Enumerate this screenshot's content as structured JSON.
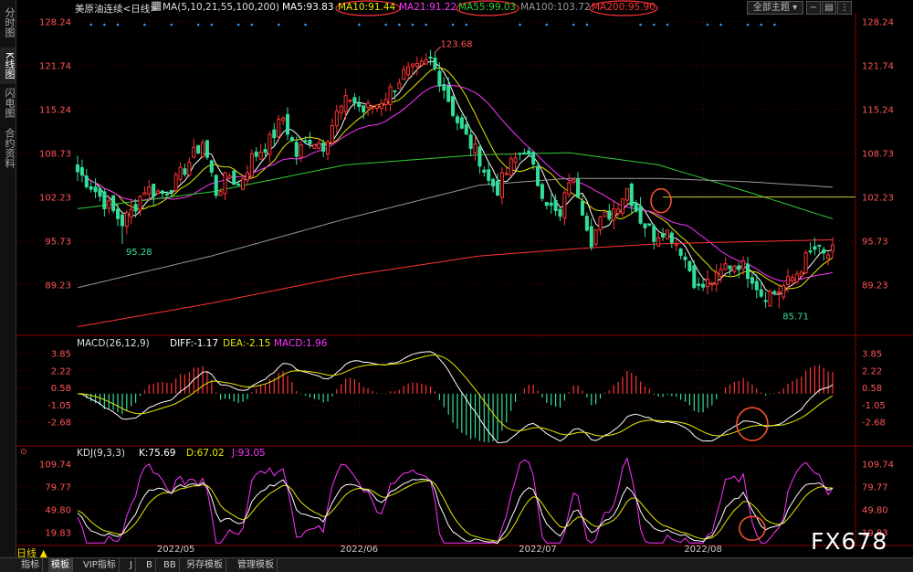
{
  "sidebar": {
    "tabs": [
      {
        "label": "分时图",
        "active": false
      },
      {
        "label": "K线图",
        "active": true
      },
      {
        "label": "闪电图",
        "active": false
      },
      {
        "label": "合约资料",
        "active": false
      }
    ]
  },
  "header": {
    "symbol": "美原油连续<日线>",
    "ma_params": "MA(5,10,21,55,100,200)",
    "ma5": "MA5:93.83",
    "ma10": "MA10:91.44",
    "ma21": "MA21:91.22",
    "ma55": "MA55:99.03",
    "ma100": "MA100:103.72",
    "ma200": "MA200:95.90",
    "theme_button": "全部主题",
    "colors": {
      "ma5": "#ffffff",
      "ma10": "#e6e600",
      "ma21": "#ff33ff",
      "ma55": "#33cc33",
      "ma100": "#999999",
      "ma200": "#ff3333"
    }
  },
  "macd_header": {
    "params": "MACD(26,12,9)",
    "diff": "DIFF:-1.17",
    "dea": "DEA:-2.15",
    "macd": "MACD:1.96"
  },
  "kdj_header": {
    "params": "KDJ(9,3,3)",
    "k": "K:75.69",
    "d": "D:67.02",
    "j": "J:93.05"
  },
  "bottom_bar": {
    "period": "日线 ▲",
    "tabs": [
      "指标",
      "模板",
      "VIP指标",
      "J",
      "B",
      "BB",
      "另存模板",
      "管理模板"
    ],
    "active_tab": "模板"
  },
  "watermark": "FX678",
  "chart_data": [
    {
      "type": "candlestick",
      "title": "美原油连续<日线>",
      "ylim": [
        82,
        129
      ],
      "y_ticks": [
        128.24,
        121.74,
        115.24,
        108.73,
        102.23,
        95.73,
        89.23
      ],
      "x_tick_labels": [
        {
          "label": "2022/05",
          "index": 22
        },
        {
          "label": "2022/06",
          "index": 63
        },
        {
          "label": "2022/07",
          "index": 103
        },
        {
          "label": "2022/08",
          "index": 140
        }
      ],
      "annotations": [
        {
          "text": "123.68",
          "index": 80,
          "value": 123.68,
          "kind": "high"
        },
        {
          "text": "95.28",
          "index": 10,
          "value": 95.28,
          "kind": "low"
        },
        {
          "text": "85.71",
          "index": 157,
          "value": 85.71,
          "kind": "low"
        }
      ],
      "reference_line": {
        "value": 102.23,
        "from_index": 131
      },
      "anchors": [
        [
          0,
          106.0
        ],
        [
          3,
          104.0
        ],
        [
          6,
          101.5
        ],
        [
          10,
          98.5
        ],
        [
          12,
          100.0
        ],
        [
          15,
          103.5
        ],
        [
          19,
          102.8
        ],
        [
          22,
          104.5
        ],
        [
          25,
          107.5
        ],
        [
          28,
          110.5
        ],
        [
          31,
          103.0
        ],
        [
          34,
          105.5
        ],
        [
          36,
          104.0
        ],
        [
          39,
          108.0
        ],
        [
          43,
          110.5
        ],
        [
          46,
          114.0
        ],
        [
          49,
          108.5
        ],
        [
          52,
          111.0
        ],
        [
          55,
          110.0
        ],
        [
          58,
          114.5
        ],
        [
          61,
          117.0
        ],
        [
          64,
          115.0
        ],
        [
          67,
          116.0
        ],
        [
          70,
          118.0
        ],
        [
          73,
          120.5
        ],
        [
          76,
          121.0
        ],
        [
          79,
          122.5
        ],
        [
          82,
          118.5
        ],
        [
          84,
          115.0
        ],
        [
          86,
          112.0
        ],
        [
          88,
          110.0
        ],
        [
          90,
          108.0
        ],
        [
          92,
          104.5
        ],
        [
          94,
          103.5
        ],
        [
          97,
          107.0
        ],
        [
          100,
          109.5
        ],
        [
          103,
          104.5
        ],
        [
          106,
          100.5
        ],
        [
          108,
          99.0
        ],
        [
          110,
          105.0
        ],
        [
          112,
          103.0
        ],
        [
          115,
          96.0
        ],
        [
          117,
          98.5
        ],
        [
          120,
          100.5
        ],
        [
          123,
          103.5
        ],
        [
          126,
          99.0
        ],
        [
          129,
          96.5
        ],
        [
          131,
          97.5
        ],
        [
          133,
          96.5
        ],
        [
          135,
          94.5
        ],
        [
          137,
          91.5
        ],
        [
          139,
          88.5
        ],
        [
          141,
          89.5
        ],
        [
          143,
          90.0
        ],
        [
          145,
          92.0
        ],
        [
          148,
          92.5
        ],
        [
          151,
          90.5
        ],
        [
          153,
          88.0
        ],
        [
          155,
          88.0
        ],
        [
          157,
          88.5
        ],
        [
          159,
          89.5
        ],
        [
          161,
          91.0
        ],
        [
          163,
          93.0
        ],
        [
          165,
          94.5
        ],
        [
          167,
          93.5
        ],
        [
          169,
          94.0
        ]
      ],
      "series": [
        {
          "name": "MA5",
          "color": "#ffffff"
        },
        {
          "name": "MA10",
          "color": "#e6e600"
        },
        {
          "name": "MA21",
          "color": "#ff33ff"
        },
        {
          "name": "MA55",
          "color": "#33cc33"
        },
        {
          "name": "MA100",
          "color": "#999999"
        },
        {
          "name": "MA200",
          "color": "#ff3333"
        }
      ],
      "long_ma_anchors": {
        "MA55": [
          [
            0,
            100.5
          ],
          [
            30,
            103.0
          ],
          [
            60,
            107.0
          ],
          [
            90,
            108.5
          ],
          [
            110,
            108.8
          ],
          [
            130,
            107.0
          ],
          [
            150,
            103.0
          ],
          [
            169,
            99.0
          ]
        ],
        "MA100": [
          [
            0,
            88.8
          ],
          [
            30,
            93.5
          ],
          [
            60,
            99.0
          ],
          [
            90,
            104.0
          ],
          [
            110,
            105.0
          ],
          [
            130,
            105.0
          ],
          [
            150,
            104.5
          ],
          [
            169,
            103.7
          ]
        ],
        "MA200": [
          [
            0,
            83.0
          ],
          [
            30,
            86.5
          ],
          [
            60,
            90.5
          ],
          [
            90,
            93.5
          ],
          [
            110,
            94.5
          ],
          [
            130,
            95.3
          ],
          [
            169,
            95.9
          ]
        ]
      }
    },
    {
      "type": "macd",
      "params": "MACD(26,12,9)",
      "ylim": [
        -4.8,
        4.6
      ],
      "y_ticks": [
        3.85,
        2.22,
        0.58,
        -1.05,
        -2.68
      ],
      "diff_last": -1.17,
      "dea_last": -2.15,
      "macd_last": 1.96
    },
    {
      "type": "kdj",
      "params": "KDJ(9,3,3)",
      "ylim": [
        5,
        120
      ],
      "y_ticks": [
        109.74,
        79.77,
        49.8,
        19.83
      ],
      "k_last": 75.69,
      "d_last": 67.02,
      "j_last": 93.05
    }
  ]
}
